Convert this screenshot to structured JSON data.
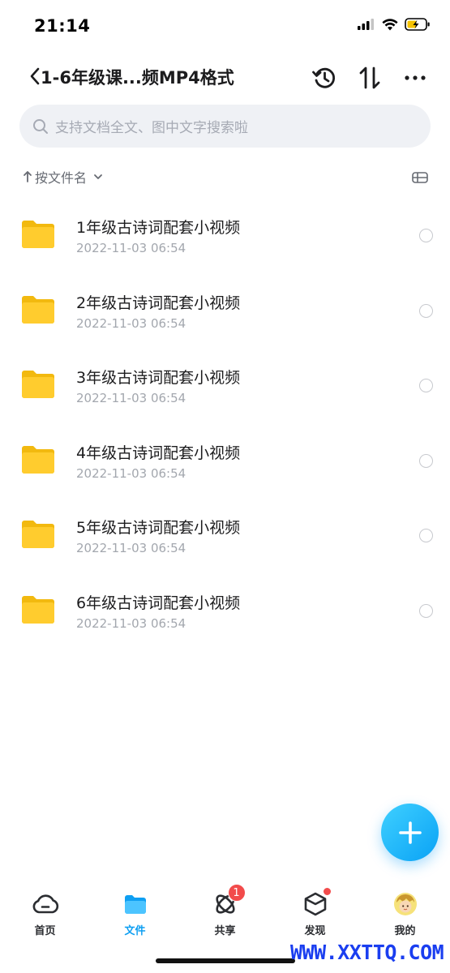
{
  "status_bar": {
    "time": "21:14"
  },
  "nav": {
    "title": "1-6年级课...频MP4格式",
    "actions": [
      "history-icon",
      "sort-order-icon",
      "more-icon"
    ]
  },
  "search": {
    "placeholder": "支持文档全文、图中文字搜索啦"
  },
  "sort": {
    "label": "按文件名"
  },
  "files": [
    {
      "name": "1年级古诗词配套小视频",
      "date": "2022-11-03 06:54"
    },
    {
      "name": "2年级古诗词配套小视频",
      "date": "2022-11-03 06:54"
    },
    {
      "name": "3年级古诗词配套小视频",
      "date": "2022-11-03 06:54"
    },
    {
      "name": "4年级古诗词配套小视频",
      "date": "2022-11-03 06:54"
    },
    {
      "name": "5年级古诗词配套小视频",
      "date": "2022-11-03 06:54"
    },
    {
      "name": "6年级古诗词配套小视频",
      "date": "2022-11-03 06:54"
    }
  ],
  "tabs": [
    {
      "label": "首页",
      "icon": "cloud-home-icon",
      "active": false
    },
    {
      "label": "文件",
      "icon": "folder-icon",
      "active": true
    },
    {
      "label": "共享",
      "icon": "orbit-share-icon",
      "active": false,
      "badge": "1"
    },
    {
      "label": "发现",
      "icon": "cube-discover-icon",
      "active": false,
      "dot": true
    },
    {
      "label": "我的",
      "icon": "avatar",
      "active": false
    }
  ],
  "watermark": "WWW.XXTTQ.COM",
  "colors": {
    "accent": "#0e9ff2",
    "folder": "#ffcc2e",
    "badge": "#f24b4b"
  }
}
